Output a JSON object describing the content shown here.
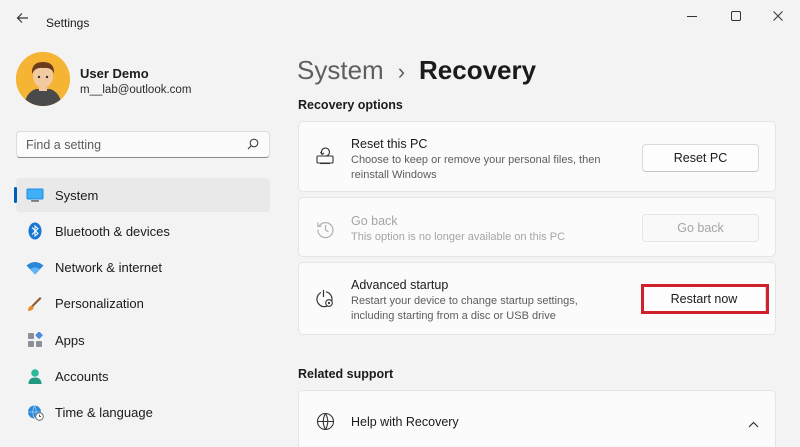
{
  "window": {
    "app_title": "Settings",
    "back_icon": "arrow-left-icon",
    "controls": [
      "minimize-icon",
      "maximize-icon",
      "close-icon"
    ]
  },
  "profile": {
    "name": "User Demo",
    "email": "m__lab@outlook.com"
  },
  "search": {
    "placeholder": "Find a setting"
  },
  "sidebar": {
    "items": [
      {
        "label": "System",
        "icon": "monitor-icon",
        "active": true
      },
      {
        "label": "Bluetooth & devices",
        "icon": "bluetooth-icon"
      },
      {
        "label": "Network & internet",
        "icon": "wifi-icon"
      },
      {
        "label": "Personalization",
        "icon": "brush-icon"
      },
      {
        "label": "Apps",
        "icon": "apps-icon"
      },
      {
        "label": "Accounts",
        "icon": "person-icon"
      },
      {
        "label": "Time & language",
        "icon": "globe-clock-icon"
      }
    ]
  },
  "breadcrumb": {
    "parent": "System",
    "separator": "›",
    "current": "Recovery"
  },
  "recovery_options": {
    "title": "Recovery options",
    "items": [
      {
        "title": "Reset this PC",
        "description": "Choose to keep or remove your personal files, then reinstall Windows",
        "button": "Reset PC",
        "icon": "reset-pc-icon"
      },
      {
        "title": "Go back",
        "description": "This option is no longer available on this PC",
        "button": "Go back",
        "icon": "history-icon",
        "disabled": true
      },
      {
        "title": "Advanced startup",
        "description": "Restart your device to change startup settings, including starting from a disc or USB drive",
        "button": "Restart now",
        "icon": "advanced-startup-icon"
      }
    ]
  },
  "related_support": {
    "title": "Related support",
    "items": [
      {
        "title": "Help with Recovery",
        "icon": "globe-icon",
        "expanded": true
      }
    ]
  },
  "colors": {
    "accent": "#005fb8",
    "highlight": "#d0202c",
    "avatar_bg": "#f6b434"
  }
}
